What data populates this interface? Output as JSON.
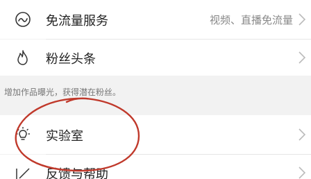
{
  "menu": {
    "items": [
      {
        "label": "免流量服务",
        "value": "视频、直播免流量",
        "icon": "wave-circle-icon"
      },
      {
        "label": "粉丝头条",
        "value": "",
        "icon": "flame-icon"
      },
      {
        "label": "实验室",
        "value": "",
        "icon": "lightbulb-icon"
      },
      {
        "label": "反馈与帮助",
        "value": "",
        "icon": "edit-square-icon"
      }
    ],
    "section_note": "增加作品曝光，获得潜在粉丝。"
  },
  "colors": {
    "background": "#f2f2f2",
    "row_background": "#ffffff",
    "text": "#222222",
    "secondary_text": "#888888",
    "annotation_red": "#c0392b"
  }
}
